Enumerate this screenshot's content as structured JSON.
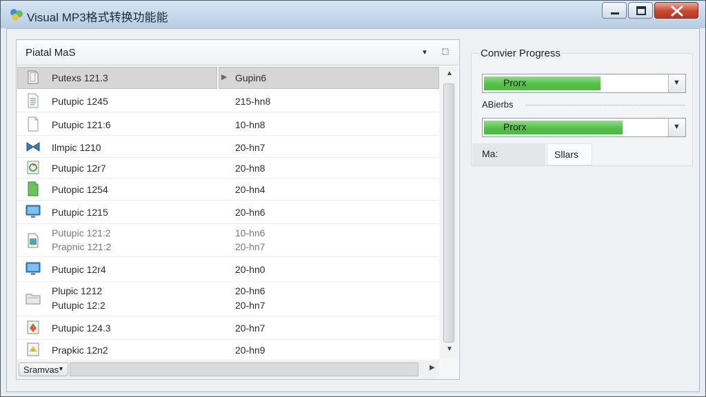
{
  "window": {
    "title": "Visual MP3格式转换功能能"
  },
  "controls": {
    "minimize": "minimize",
    "maximize": "maximize",
    "close": "close"
  },
  "list_header": {
    "combo_text": "Piatal MaS"
  },
  "rows": [
    {
      "name": "Putexs 121.3",
      "size": "Gupin6",
      "icon": "document-icon",
      "selected": true
    },
    {
      "name": "Putupic 1245",
      "size": "215-hn8",
      "icon": "text-file-icon"
    },
    {
      "name": "Putupic 121:6",
      "size": "10-hn8",
      "icon": "blank-file-icon"
    },
    {
      "name": "Ilmpic 1210",
      "size": "20-hn7",
      "icon": "bowtie-file-icon"
    },
    {
      "name": "Putupic 12r7",
      "size": "20-hn8",
      "icon": "recycle-file-icon"
    },
    {
      "name": "Putopic 1254",
      "size": "20-hn4",
      "icon": "green-file-icon"
    },
    {
      "name": "Putupic 1215",
      "size": "20-hn6",
      "icon": "monitor-icon"
    },
    {
      "name": "Putupic 121:2",
      "name2": "Prapnic 121:2",
      "size": "10-hn6",
      "size2": "20-hn7",
      "icon": "image-file-icon"
    },
    {
      "name": "Putupic 12r4",
      "size": "20-hn0",
      "icon": "monitor-icon"
    },
    {
      "name": "Plupic 1212",
      "name2": "Putupic 12:2",
      "size": "20-hn6",
      "size2": "20-hn7",
      "icon": "folder-icon"
    },
    {
      "name": "Putupic 124.3",
      "size": "20-hn7",
      "icon": "colorful-file-icon"
    },
    {
      "name": "Prapkic 12n2",
      "size": "20-hn9",
      "icon": "yellow-file-icon"
    }
  ],
  "statusbar": {
    "button": "Sramvas"
  },
  "progress": {
    "title": "Convier Progress",
    "bar1": {
      "label": "Prorx",
      "level": 0.63
    },
    "advanced_label": "ABierbs",
    "bar2": {
      "label": "Prorx",
      "level": 0.75
    },
    "tabs": [
      "Ma:",
      "Sllars"
    ]
  }
}
